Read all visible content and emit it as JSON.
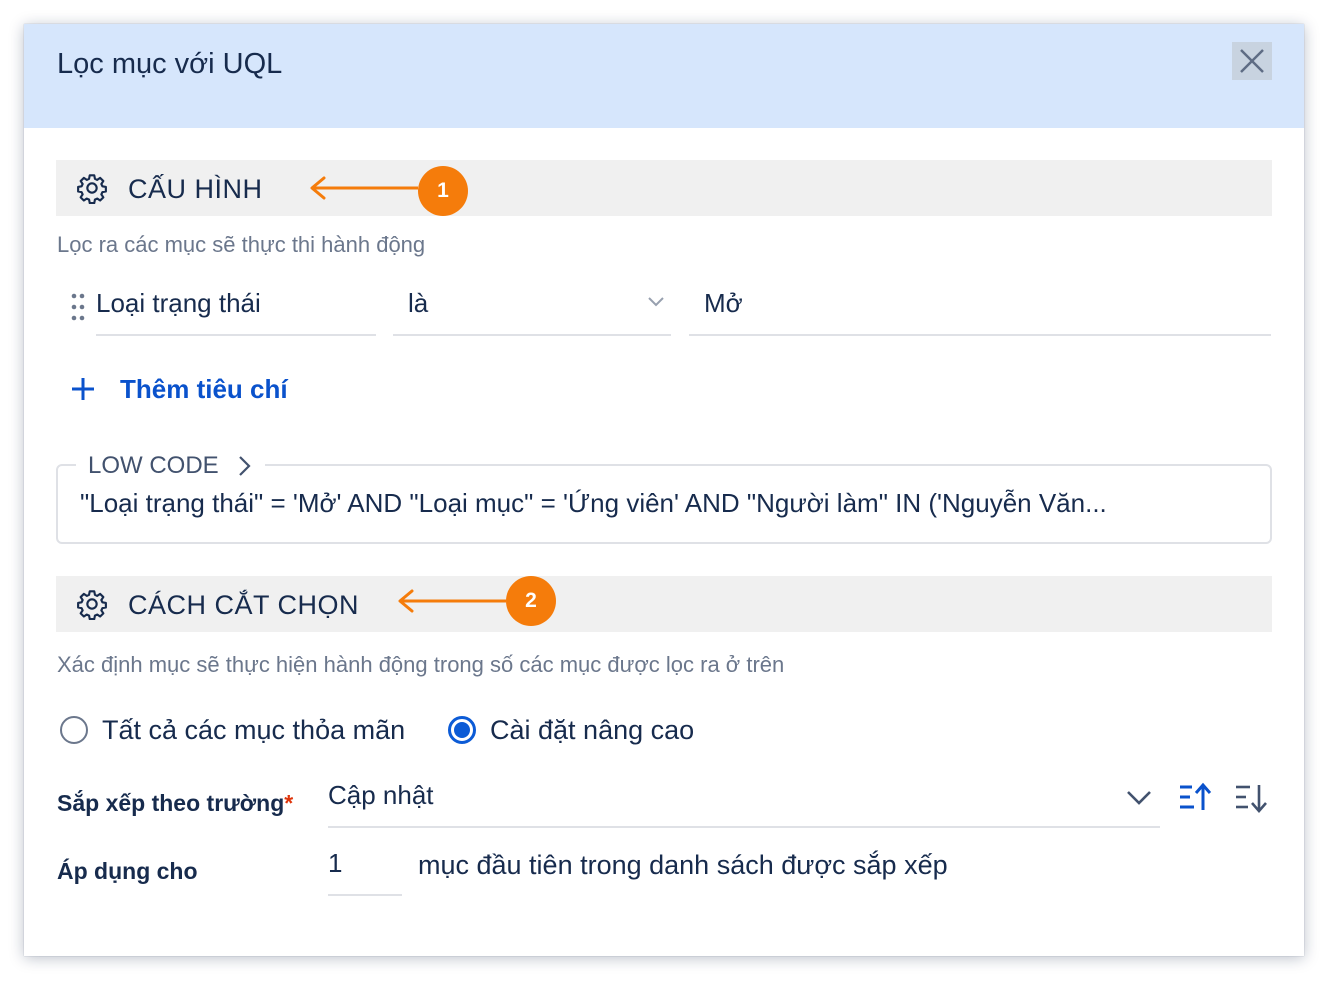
{
  "dialog": {
    "title": "Lọc mục với UQL"
  },
  "config_section": {
    "title": "CẤU HÌNH",
    "badge": "1",
    "description": "Lọc ra các mục sẽ thực thi hành động",
    "criterion": {
      "field": "Loại trạng thái",
      "operator": "là",
      "value": "Mở"
    },
    "add_criterion_label": "Thêm tiêu chí",
    "low_code": {
      "label": "LOW CODE",
      "query": "\"Loại trạng thái\" = 'Mở' AND \"Loại mục\" = 'Ứng viên' AND \"Người làm\" IN ('Nguyễn Văn..."
    }
  },
  "selection_section": {
    "title": "CÁCH CẮT CHỌN",
    "badge": "2",
    "description": "Xác định mục sẽ thực hiện hành động trong số các mục được lọc ra ở trên",
    "options": [
      {
        "label": "Tất cả các mục thỏa mãn",
        "selected": false
      },
      {
        "label": "Cài đặt nâng cao",
        "selected": true
      }
    ],
    "sort_field": {
      "label": "Sắp xếp theo trường",
      "required_mark": "*",
      "value": "Cập nhật",
      "sort_icons": [
        "sort-ascending-icon",
        "sort-descending-icon"
      ]
    },
    "apply_to": {
      "label": "Áp dụng cho",
      "value": "1",
      "suffix": "mục đầu tiên trong danh sách được sắp xếp"
    }
  },
  "colors": {
    "header_bg": "#d6e6fc",
    "accent_orange": "#f57c0b",
    "link_blue": "#0a52cc",
    "radio_blue": "#0c5bd6"
  }
}
